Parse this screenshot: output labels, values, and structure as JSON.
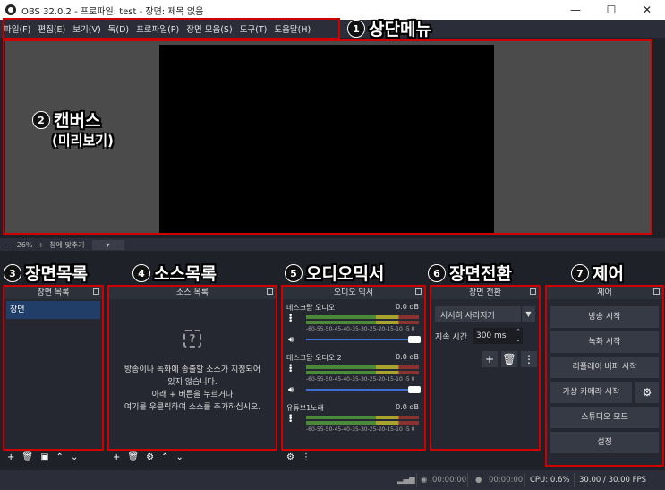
{
  "window": {
    "title": "OBS 32.0.2 - 프로파일: test - 장면: 제목 없음",
    "minimize": "—",
    "maximize": "☐",
    "close": "✕"
  },
  "menu": [
    "파일(F)",
    "편집(E)",
    "보기(V)",
    "독(D)",
    "프로파일(P)",
    "장면 모음(S)",
    "도구(T)",
    "도움말(H)"
  ],
  "zoom": {
    "minus": "−",
    "level": "26%",
    "plus": "+",
    "fit": "창에 맞추기",
    "dropdown": "▾"
  },
  "docks": {
    "scenes": {
      "title": "장면 목록",
      "items": [
        "장면"
      ]
    },
    "sources": {
      "title": "소스 목록",
      "empty_icon": "?",
      "empty_line1": "방송이나 녹화에 송출할 소스가 지정되어",
      "empty_line2": "있지 않습니다.",
      "empty_line3": "아래 + 버튼을 누르거나",
      "empty_line4": "여기를 우클릭하여 소스를 추가하십시오."
    },
    "mixer": {
      "title": "오디오 믹서",
      "ticks": "-60-55-50-45-40-35-30-25-20-15-10 -5 0",
      "channels": [
        {
          "name": "데스크탑 오디오",
          "db": "0.0 dB"
        },
        {
          "name": "데스크탑 오디오 2",
          "db": "0.0 dB"
        },
        {
          "name": "유튜브1노래",
          "db": "0.0 dB"
        }
      ]
    },
    "transitions": {
      "title": "장면 전환",
      "type": "서서히 사라지기",
      "duration_label": "지속 시간",
      "duration_value": "300 ms"
    },
    "controls": {
      "title": "제어",
      "stream": "방송 시작",
      "record": "녹화 시작",
      "replay": "리플레이 버퍼 시작",
      "vcam": "가상 카메라 시작",
      "studio": "스튜디오 모드",
      "settings": "설정"
    }
  },
  "status": {
    "rec_time": "00:00:00",
    "stream_time": "00:00:00",
    "cpu": "CPU: 0.6%",
    "fps": "30.00 / 30.00 FPS"
  },
  "annotations": {
    "c1": {
      "num": "1",
      "label": "상단메뉴"
    },
    "c2": {
      "num": "2",
      "label": "캔버스",
      "sub": "(미리보기)"
    },
    "c3": {
      "num": "3",
      "label": "장면목록"
    },
    "c4": {
      "num": "4",
      "label": "소스목록"
    },
    "c5": {
      "num": "5",
      "label": "오디오믹서"
    },
    "c6": {
      "num": "6",
      "label": "장면전환"
    },
    "c7": {
      "num": "7",
      "label": "제어"
    }
  },
  "colors": {
    "highlight": "#d10000",
    "panel": "#252830",
    "selected": "#213e68"
  }
}
